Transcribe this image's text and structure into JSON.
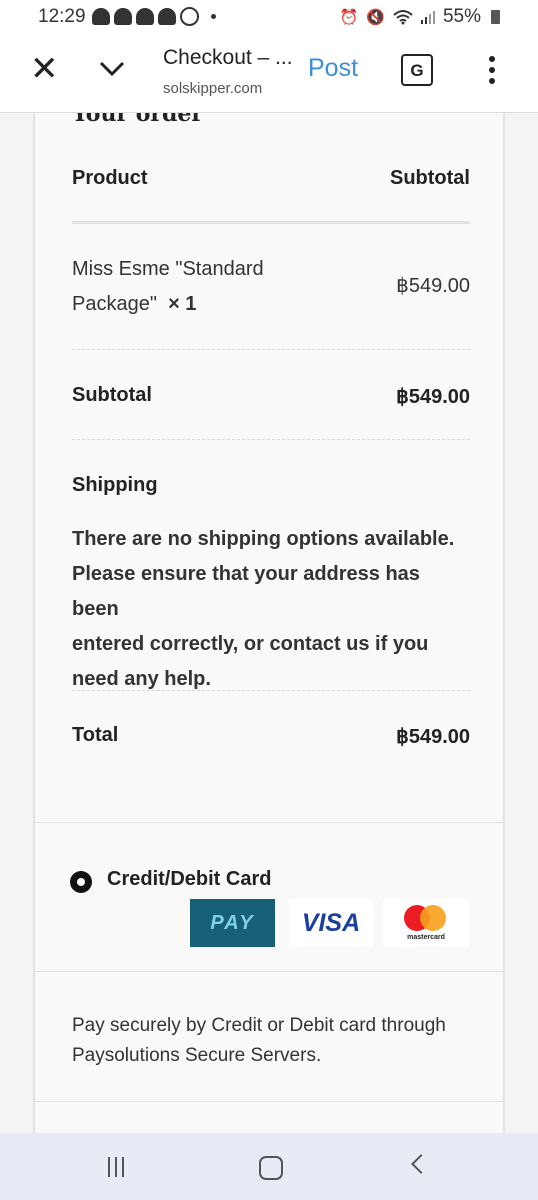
{
  "status_bar": {
    "time": "12:29",
    "battery": "55%",
    "notification_icons": [
      "snapchat-icon",
      "snapchat-icon",
      "snapchat-icon",
      "snapchat-icon",
      "whatsapp-icon"
    ],
    "system_icons": [
      "alarm-icon",
      "mute-icon",
      "wifi-icon",
      "signal-icon",
      "battery-icon"
    ]
  },
  "tab_bar": {
    "title": "Checkout – ...",
    "url": "solskipper.com",
    "post_label": "Post",
    "translate_glyph": "G"
  },
  "order": {
    "heading": "Your order",
    "col_product": "Product",
    "col_subtotal": "Subtotal",
    "item_name_line1": "Miss Esme \"Standard",
    "item_name_line2": "Package\"",
    "item_qty": "× 1",
    "item_price": "฿549.00",
    "subtotal_label": "Subtotal",
    "subtotal_value": "฿549.00",
    "shipping_label": "Shipping",
    "shipping_message_lines": [
      "There are no shipping options available.",
      "Please ensure that your address has been",
      "entered correctly, or contact us if you",
      "need any help."
    ],
    "total_label": "Total",
    "total_value": "฿549.00"
  },
  "payment": {
    "method_label": "Credit/Debit Card",
    "logos": {
      "pay": "PAY",
      "visa": "VISA",
      "mastercard": "mastercard"
    },
    "description_lines": [
      "Pay securely by Credit or Debit card through",
      "Paysolutions Secure Servers."
    ]
  }
}
